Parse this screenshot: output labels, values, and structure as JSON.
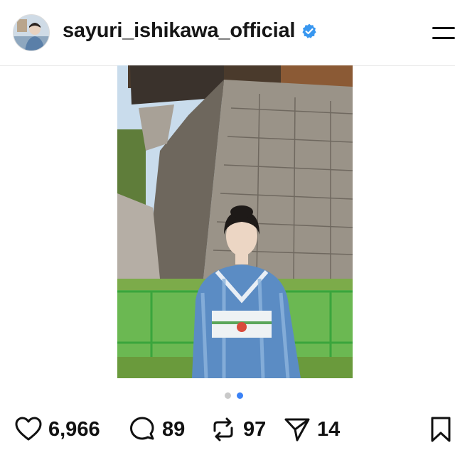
{
  "post": {
    "username": "sayuri_ishikawa_official",
    "verified": true,
    "verified_color": "#3897f0"
  },
  "carousel": {
    "total": 2,
    "active_index": 1,
    "active_color": "#3b82f6"
  },
  "actions": {
    "likes": "6,966",
    "comments": "89",
    "reposts": "97",
    "shares": "14"
  },
  "icons": [
    "menu-icon",
    "heart-icon",
    "comment-icon",
    "repost-icon",
    "share-icon",
    "bookmark-icon",
    "verified-badge-icon"
  ]
}
